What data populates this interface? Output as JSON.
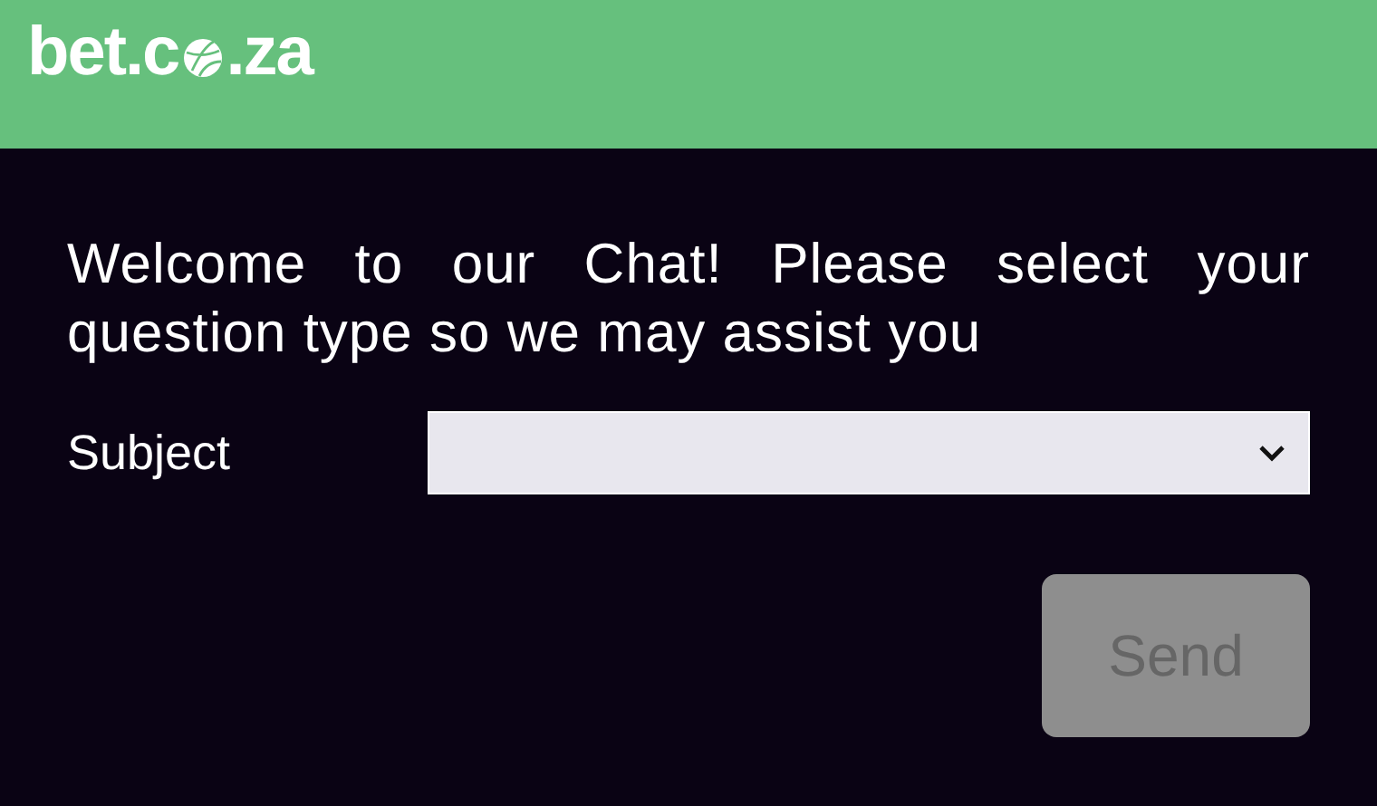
{
  "header": {
    "logo_start": "bet.c",
    "logo_end": ".za"
  },
  "intro": "Welcome to our Chat! Please select your question type so we may assist you",
  "subject": {
    "label": "Subject"
  },
  "send_button": {
    "label": "Send",
    "disabled": true
  }
}
